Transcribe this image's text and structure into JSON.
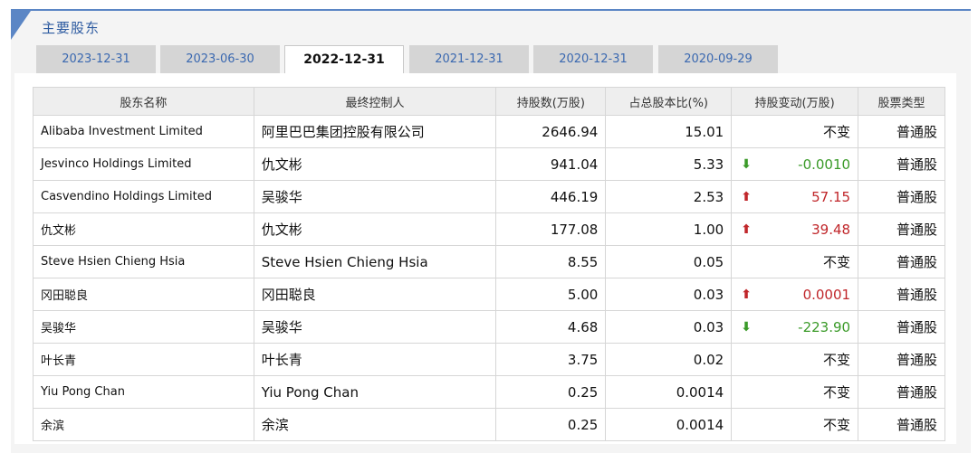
{
  "section": {
    "title": "主要股东"
  },
  "tabs": [
    {
      "label": "2023-12-31",
      "active": false
    },
    {
      "label": "2023-06-30",
      "active": false
    },
    {
      "label": "2022-12-31",
      "active": true
    },
    {
      "label": "2021-12-31",
      "active": false
    },
    {
      "label": "2020-12-31",
      "active": false
    },
    {
      "label": "2020-09-29",
      "active": false
    }
  ],
  "table": {
    "headers": [
      "股东名称",
      "最终控制人",
      "持股数(万股)",
      "占总股本比(%)",
      "持股变动(万股)",
      "股票类型"
    ],
    "rows": [
      {
        "name": "Alibaba Investment Limited",
        "controller": "阿里巴巴集团控股有限公司",
        "shares": "2646.94",
        "ratio": "15.01",
        "change": "不变",
        "direction": "flat",
        "type": "普通股"
      },
      {
        "name": "Jesvinco Holdings Limited",
        "controller": "仇文彬",
        "shares": "941.04",
        "ratio": "5.33",
        "change": "-0.0010",
        "direction": "down",
        "type": "普通股"
      },
      {
        "name": "Casvendino Holdings Limited",
        "controller": "吴骏华",
        "shares": "446.19",
        "ratio": "2.53",
        "change": "57.15",
        "direction": "up",
        "type": "普通股"
      },
      {
        "name": "仇文彬",
        "controller": "仇文彬",
        "shares": "177.08",
        "ratio": "1.00",
        "change": "39.48",
        "direction": "up",
        "type": "普通股"
      },
      {
        "name": "Steve Hsien Chieng Hsia",
        "controller": "Steve Hsien Chieng Hsia",
        "shares": "8.55",
        "ratio": "0.05",
        "change": "不变",
        "direction": "flat",
        "type": "普通股"
      },
      {
        "name": "冈田聪良",
        "controller": "冈田聪良",
        "shares": "5.00",
        "ratio": "0.03",
        "change": "0.0001",
        "direction": "up",
        "type": "普通股"
      },
      {
        "name": "吴骏华",
        "controller": "吴骏华",
        "shares": "4.68",
        "ratio": "0.03",
        "change": "-223.90",
        "direction": "down",
        "type": "普通股"
      },
      {
        "name": "叶长青",
        "controller": "叶长青",
        "shares": "3.75",
        "ratio": "0.02",
        "change": "不变",
        "direction": "flat",
        "type": "普通股"
      },
      {
        "name": "Yiu Pong Chan",
        "controller": "Yiu Pong Chan",
        "shares": "0.25",
        "ratio": "0.0014",
        "change": "不变",
        "direction": "flat",
        "type": "普通股"
      },
      {
        "name": "余滨",
        "controller": "余滨",
        "shares": "0.25",
        "ratio": "0.0014",
        "change": "不变",
        "direction": "flat",
        "type": "普通股"
      }
    ]
  },
  "icons": {
    "up": "arrow-up-icon",
    "down": "arrow-down-icon"
  },
  "colors": {
    "accent": "#5b86c5",
    "tab_link": "#3a68b0",
    "increase": "#c0262a",
    "decrease": "#3a9a28"
  }
}
